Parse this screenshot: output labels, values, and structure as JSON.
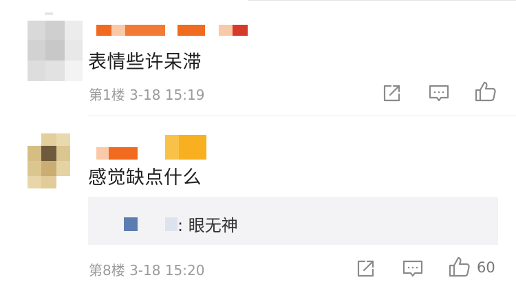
{
  "comments": [
    {
      "text": "表情些许呆滞",
      "floor_time": "第1楼 3-18 15:19",
      "actions": {
        "share_icon": "share-icon",
        "reply_icon": "comment-icon",
        "like_icon": "thumbs-up-icon"
      }
    },
    {
      "text": "感觉缺点什么",
      "floor_time": "第8楼 3-18 15:20",
      "reply": {
        "text": ": 眼无神"
      },
      "like_count": "60",
      "actions": {
        "share_icon": "share-icon",
        "reply_icon": "comment-icon",
        "like_icon": "thumbs-up-icon"
      }
    }
  ],
  "colors": {
    "username_orange": "#f06a1f",
    "username_light": "#f9c9a8",
    "username_red": "#d63a2a",
    "username_gold": "#f8b021",
    "reply_user_blue": "#5b7db1",
    "reply_user_light": "#dde3ee",
    "meta_gray": "#9a9a9a"
  }
}
